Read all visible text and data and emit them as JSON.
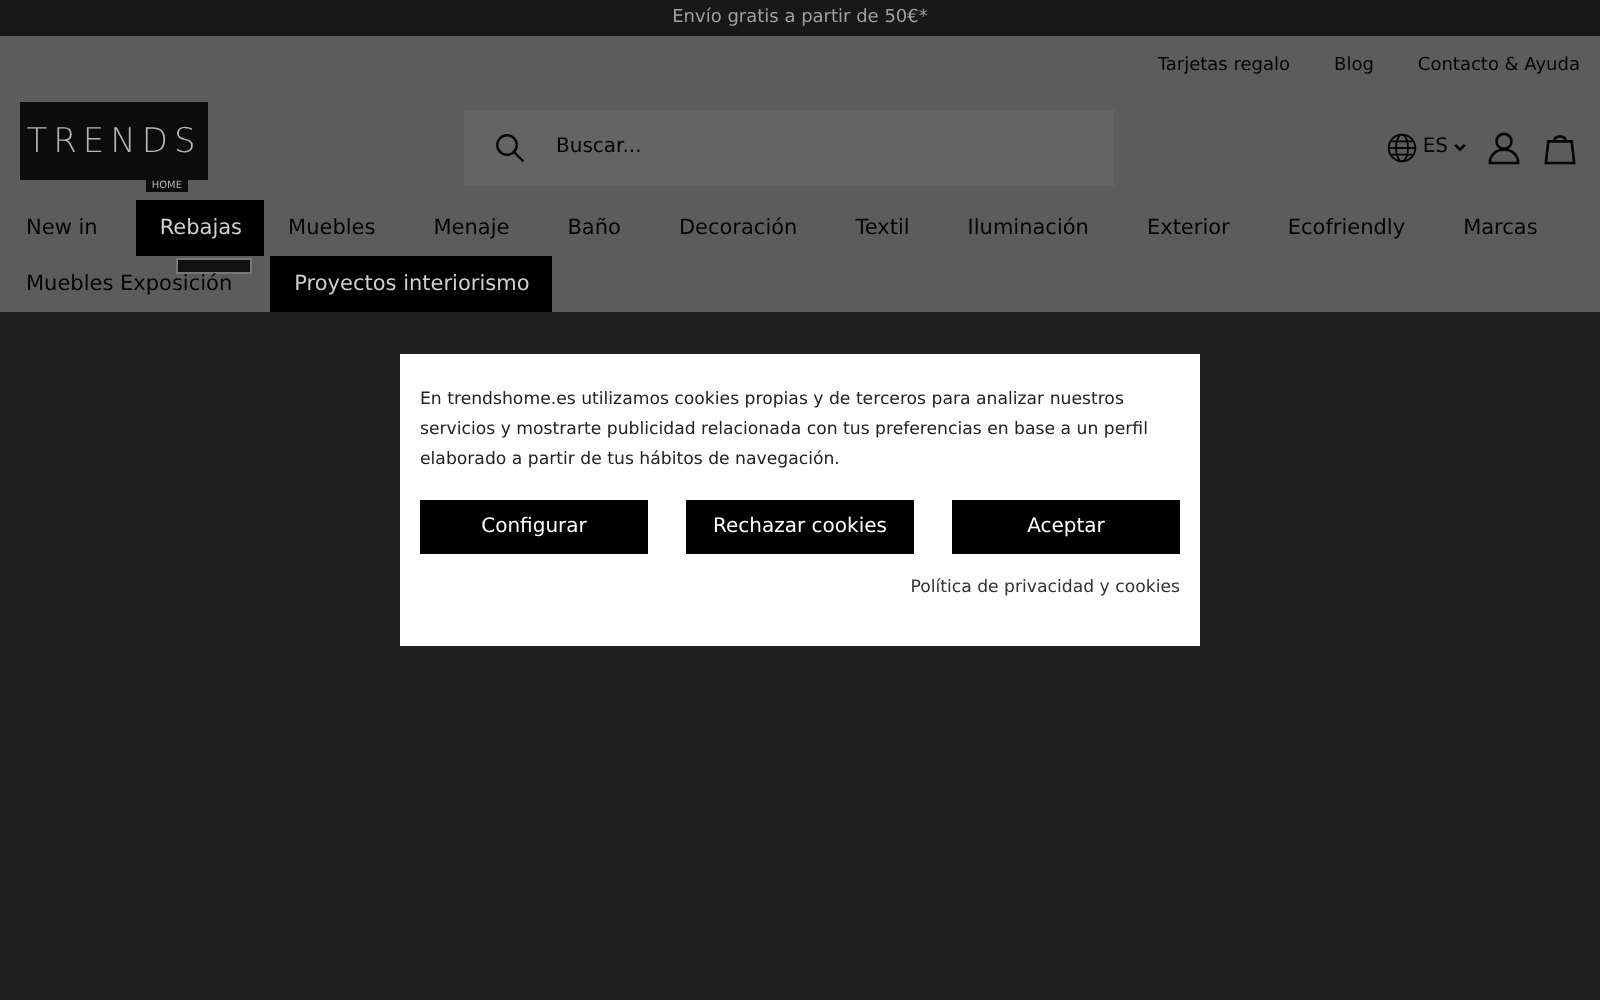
{
  "promo_bar": {
    "text": "Envío gratis a partir de 50€*"
  },
  "utility_links": [
    "Tarjetas regalo",
    "Blog",
    "Contacto & Ayuda"
  ],
  "logo": {
    "text": "TRENDS",
    "subtitle": "HOME"
  },
  "search": {
    "placeholder": "Buscar..."
  },
  "language": {
    "label": "ES"
  },
  "nav_rows": [
    [
      {
        "label": "New in",
        "selected": false
      },
      {
        "label": "Rebajas",
        "selected": true,
        "tag": true
      },
      {
        "label": "Muebles",
        "selected": false
      },
      {
        "label": "Menaje",
        "selected": false
      },
      {
        "label": "Baño",
        "selected": false
      },
      {
        "label": "Decoración",
        "selected": false
      },
      {
        "label": "Textil",
        "selected": false
      },
      {
        "label": "Iluminación",
        "selected": false
      },
      {
        "label": "Exterior",
        "selected": false
      },
      {
        "label": "Ecofriendly",
        "selected": false
      },
      {
        "label": "Marcas",
        "selected": false
      }
    ],
    [
      {
        "label": "Muebles Exposición",
        "selected": false
      },
      {
        "label": "Proyectos interiorismo",
        "selected": true
      }
    ]
  ],
  "cookie_dialog": {
    "text": "En trendshome.es utilizamos cookies propias y de terceros para analizar nuestros servicios y mostrarte publicidad relacionada con tus preferencias en base a un perfil elaborado a partir de tus hábitos de navegación.",
    "buttons": [
      "Configurar",
      "Rechazar cookies",
      "Aceptar"
    ],
    "link": "Política de privacidad y cookies"
  }
}
